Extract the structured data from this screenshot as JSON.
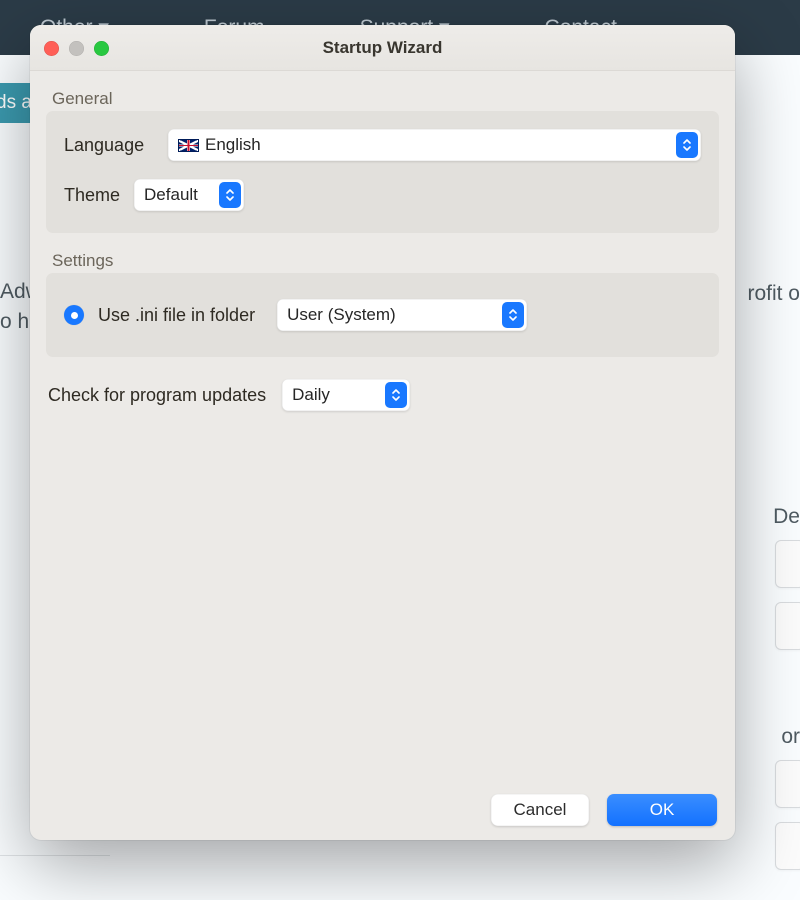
{
  "background": {
    "nav": {
      "other": "Other ▾",
      "forum": "Forum",
      "support": "Support ▾",
      "contact": "Contact"
    },
    "pill": "ds a",
    "left1": " Adw",
    "left2": "o he",
    "right1": "rofit o",
    "right2": "De",
    "right3": "or"
  },
  "window": {
    "title": "Startup Wizard",
    "buttons": {
      "cancel": "Cancel",
      "ok": "OK"
    },
    "general": {
      "legend": "General",
      "language_label": "Language",
      "language_value": "English",
      "theme_label": "Theme",
      "theme_value": "Default"
    },
    "settings": {
      "legend": "Settings",
      "ini_label": "Use .ini file in folder",
      "ini_location_value": "User (System)"
    },
    "updates": {
      "label": "Check for program updates",
      "value": "Daily"
    }
  }
}
